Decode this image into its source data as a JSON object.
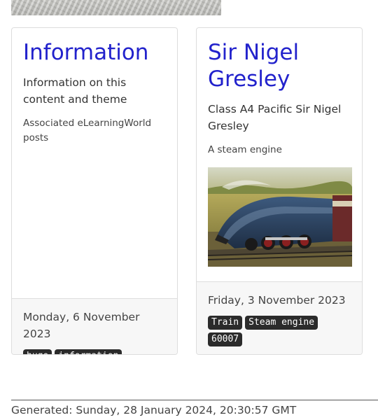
{
  "cards": [
    {
      "title": "Information",
      "subtitle": "Information on this content and theme",
      "text": "Associated eLearningWorld posts",
      "date": "Monday, 6 November 2023",
      "tags": [
        "hugo",
        "information"
      ]
    },
    {
      "title": "Sir Nigel Gresley",
      "subtitle": "Class A4 Pacific Sir Nigel Gresley",
      "text": "A steam engine",
      "image": "steam-locomotive-photo",
      "date": "Friday, 3 November 2023",
      "tags": [
        "Train",
        "Steam engine",
        "60007"
      ]
    }
  ],
  "footer": {
    "generated": "Generated: Sunday, 28 January 2024, 20:30:57 GMT"
  }
}
